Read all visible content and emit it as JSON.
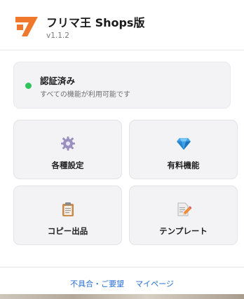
{
  "header": {
    "app_title": "フリマ王 Shops版",
    "version": "v1.1.2",
    "logo_icon": "orange-ma-logo-icon",
    "brand_color": "#f0782d"
  },
  "auth": {
    "title": "認証済み",
    "subtitle": "すべての機能が利用可能です",
    "status_color": "#2fc35a"
  },
  "tiles": [
    {
      "label": "各種設定",
      "icon": "gear-icon"
    },
    {
      "label": "有料機能",
      "icon": "diamond-icon"
    },
    {
      "label": "コピー出品",
      "icon": "clipboard-icon"
    },
    {
      "label": "テンプレート",
      "icon": "document-pencil-icon"
    }
  ],
  "footer": {
    "links": [
      "不具合・ご要望",
      "マイページ"
    ],
    "link_color": "#2a6fd6"
  }
}
